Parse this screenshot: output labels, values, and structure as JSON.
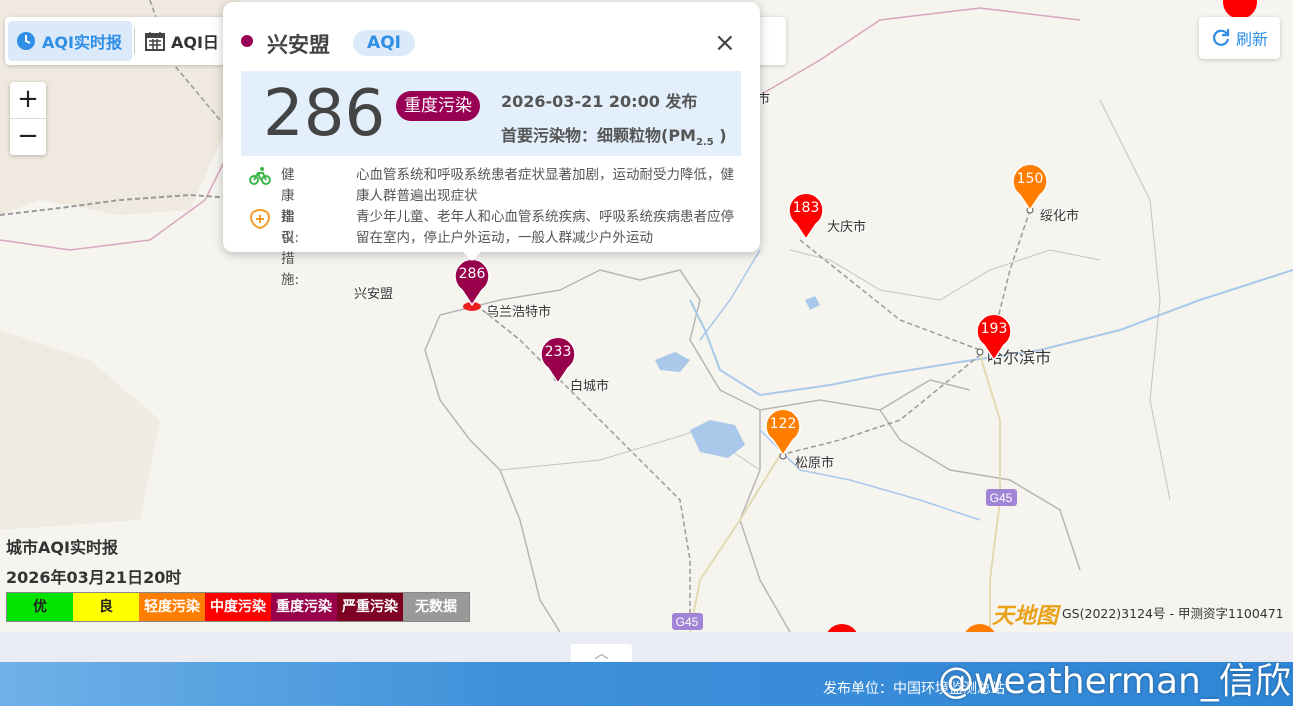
{
  "colors": {
    "excellent": "#00e400",
    "good": "#ffff00",
    "light": "#ff7e00",
    "moderate": "#ff0000",
    "heavy": "#99004c",
    "severe": "#7e0023",
    "nodata": "#999999",
    "accent": "#2f8ee6"
  },
  "toolbar": {
    "realtime_label": "AQI实时报",
    "daily_label": "AQI日",
    "realtime_icon": "clock-icon",
    "daily_icon": "calendar-icon"
  },
  "zoom": {
    "in_label": "+",
    "out_label": "−"
  },
  "refresh": {
    "label": "刷新",
    "icon": "refresh-icon"
  },
  "popup": {
    "city": "兴安盟",
    "badge": "AQI",
    "aqi": "286",
    "level": "重度污染",
    "published": "2026-03-21 20:00 发布",
    "pollutant_prefix": "首要污染物：细颗粒物(PM",
    "pollutant_sub": "2.5",
    "pollutant_suffix": " )",
    "health_label": "健康指引:",
    "health_text": "心血管系统和呼吸系统患者症状显著加剧，运动耐受力降低，健康人群普遍出现症状",
    "advice_label": "建议措施:",
    "advice_text": "青少年儿童、老年人和心血管系统疾病、呼吸系统疾病患者应停留在室内，停止户外运动，一般人群减少户外运动",
    "close_label": "×"
  },
  "markers": [
    {
      "city": "乌兰浩特市",
      "aqi": "286",
      "level": "heavy"
    },
    {
      "city": "白城市",
      "aqi": "233",
      "level": "heavy"
    },
    {
      "city": "大庆市",
      "aqi": "183",
      "level": "moderate"
    },
    {
      "city": "绥化市",
      "aqi": "150",
      "level": "light"
    },
    {
      "city": "哈尔滨市",
      "aqi": "193",
      "level": "moderate"
    },
    {
      "city": "松原市",
      "aqi": "122",
      "level": "light"
    }
  ],
  "map_labels": {
    "region": "兴安盟",
    "partial_city": "市",
    "road_1": "G45",
    "road_2": "G45"
  },
  "legend": {
    "title": "城市AQI实时报",
    "date": "2026年03月21日20时",
    "items": [
      "优",
      "良",
      "轻度污染",
      "中度污染",
      "重度污染",
      "严重污染",
      "无数据"
    ]
  },
  "copyright": "GS(2022)3124号 - 甲测资字1100471",
  "brand": "天地图",
  "footer": {
    "publisher": "发布单位：中国环境监测总站",
    "watermark": "@weatherman_信欣",
    "handle_icon": "chevron-up-icon"
  }
}
